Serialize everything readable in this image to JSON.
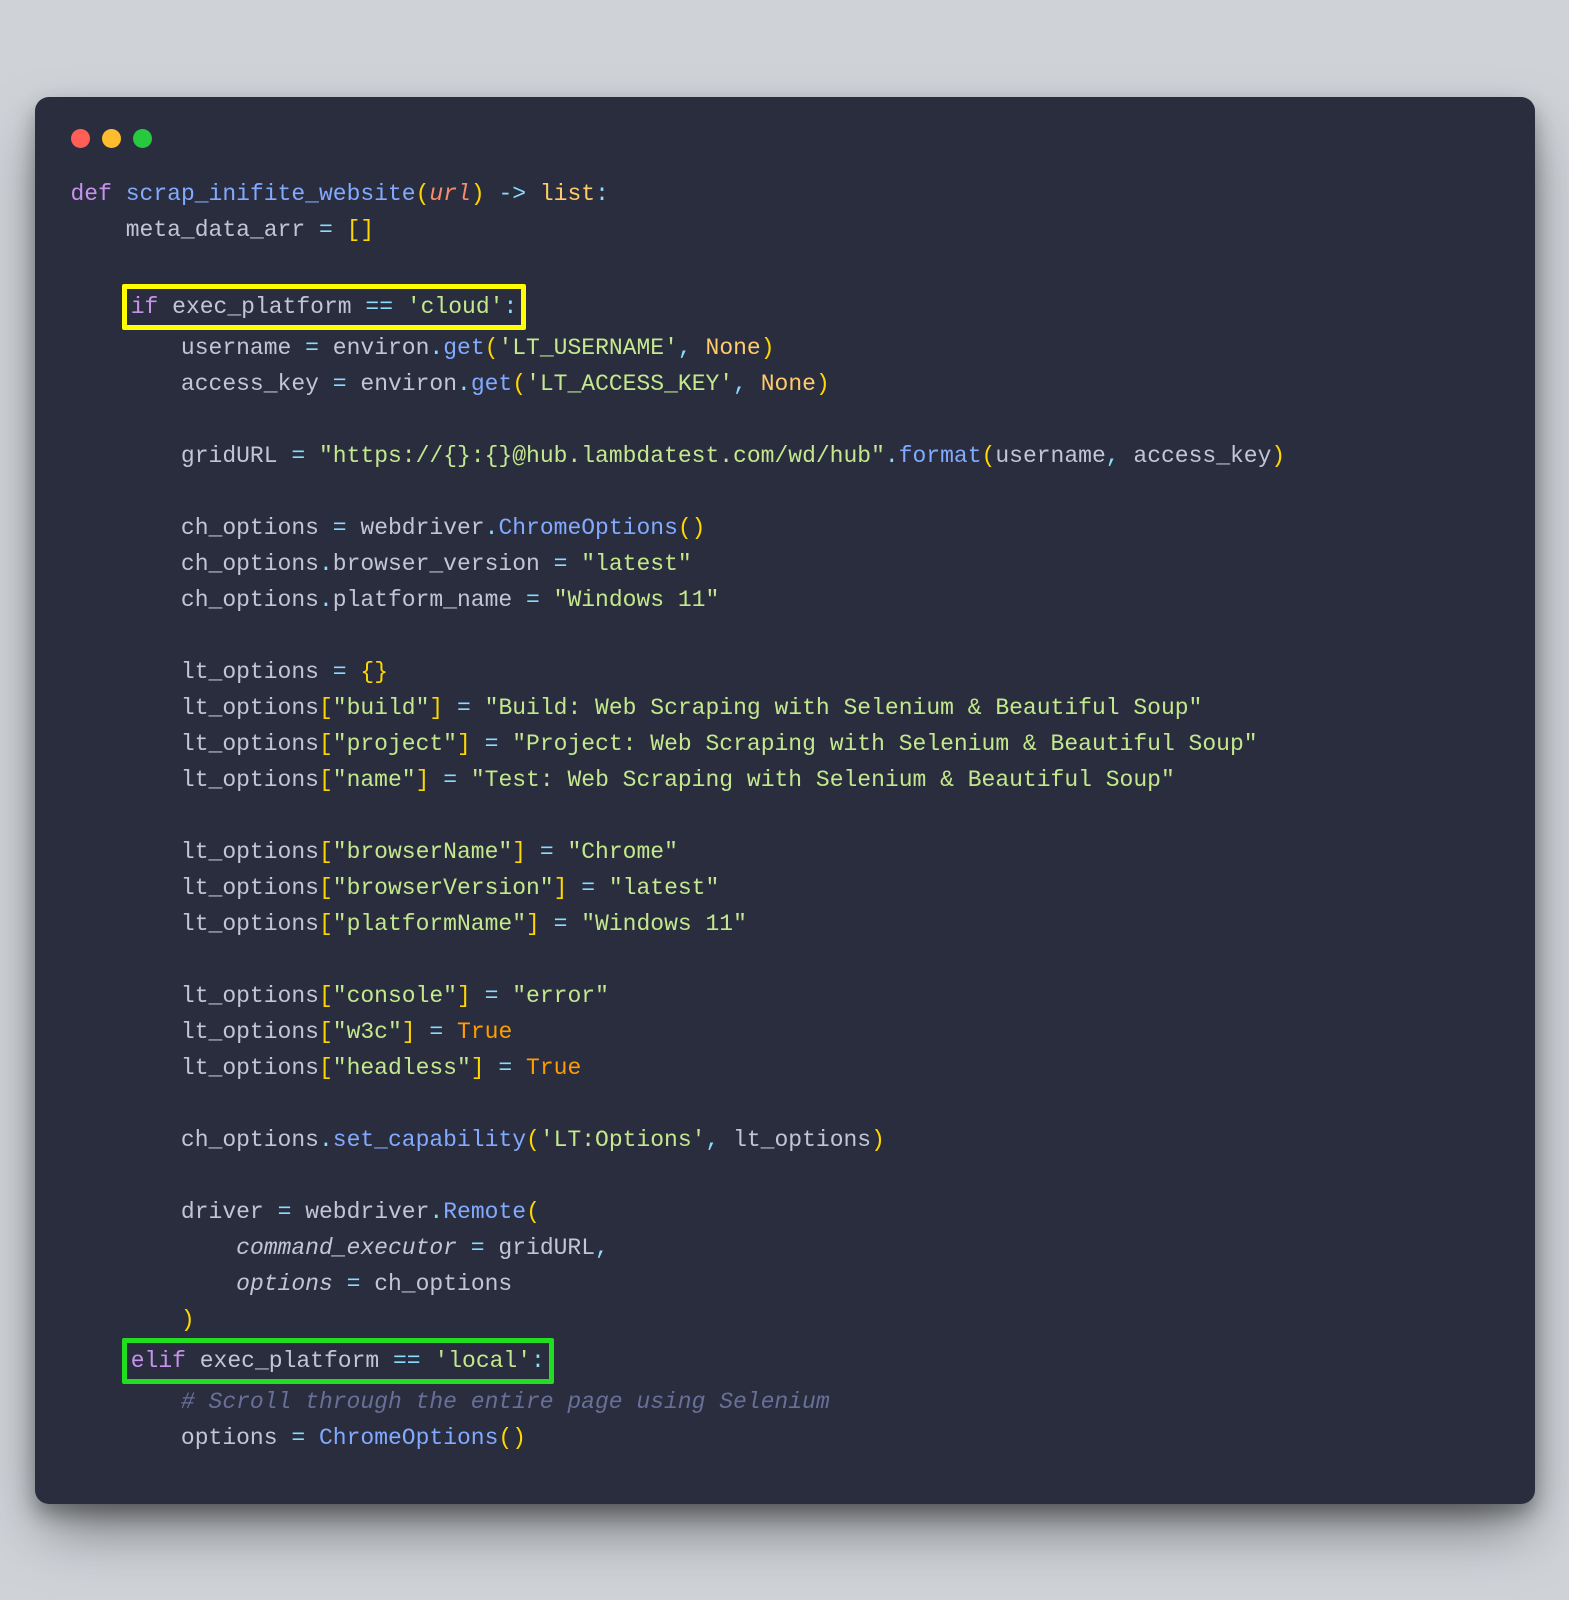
{
  "code": {
    "fn_def": {
      "kw": "def",
      "name": "scrap_inifite_website",
      "param": "url",
      "arrow": "->",
      "ret": "list"
    },
    "l2": {
      "var": "meta_data_arr",
      "eq": "=",
      "val": "[]"
    },
    "if_line": {
      "kw": "if",
      "var": "exec_platform",
      "op": "==",
      "str": "'cloud'",
      "colon": ":"
    },
    "l_user": {
      "var": "username",
      "eq": "=",
      "obj": "environ",
      "dot": ".",
      "m": "get",
      "a1": "'LT_USERNAME'",
      "c": ",",
      "a2": "None"
    },
    "l_key": {
      "var": "access_key",
      "eq": "=",
      "obj": "environ",
      "dot": ".",
      "m": "get",
      "a1": "'LT_ACCESS_KEY'",
      "c": ",",
      "a2": "None"
    },
    "l_grid": {
      "var": "gridURL",
      "eq": "=",
      "s": "\"https://{}:{}@hub.lambdatest.com/wd/hub\"",
      "dot": ".",
      "m": "format",
      "a1": "username",
      "c": ",",
      "a2": "access_key"
    },
    "l_opt": {
      "var": "ch_options",
      "eq": "=",
      "obj": "webdriver",
      "dot": ".",
      "m": "ChromeOptions"
    },
    "l_bv": {
      "obj": "ch_options",
      "dot": ".",
      "p": "browser_version",
      "eq": "=",
      "s": "\"latest\""
    },
    "l_pn": {
      "obj": "ch_options",
      "dot": ".",
      "p": "platform_name",
      "eq": "=",
      "s": "\"Windows 11\""
    },
    "l_lt": {
      "var": "lt_options",
      "eq": "=",
      "v": "{}"
    },
    "lt_build": {
      "obj": "lt_options",
      "k": "\"build\"",
      "eq": "=",
      "s": "\"Build: Web Scraping with Selenium & Beautiful Soup\""
    },
    "lt_proj": {
      "obj": "lt_options",
      "k": "\"project\"",
      "eq": "=",
      "s": "\"Project: Web Scraping with Selenium & Beautiful Soup\""
    },
    "lt_name": {
      "obj": "lt_options",
      "k": "\"name\"",
      "eq": "=",
      "s": "\"Test: Web Scraping with Selenium & Beautiful Soup\""
    },
    "lt_bn": {
      "obj": "lt_options",
      "k": "\"browserName\"",
      "eq": "=",
      "s": "\"Chrome\""
    },
    "lt_bv": {
      "obj": "lt_options",
      "k": "\"browserVersion\"",
      "eq": "=",
      "s": "\"latest\""
    },
    "lt_pn": {
      "obj": "lt_options",
      "k": "\"platformName\"",
      "eq": "=",
      "s": "\"Windows 11\""
    },
    "lt_con": {
      "obj": "lt_options",
      "k": "\"console\"",
      "eq": "=",
      "s": "\"error\""
    },
    "lt_w3c": {
      "obj": "lt_options",
      "k": "\"w3c\"",
      "eq": "=",
      "v": "True"
    },
    "lt_hl": {
      "obj": "lt_options",
      "k": "\"headless\"",
      "eq": "=",
      "v": "True"
    },
    "set_cap": {
      "obj": "ch_options",
      "dot": ".",
      "m": "set_capability",
      "a1": "'LT:Options'",
      "c": ",",
      "a2": "lt_options"
    },
    "drv": {
      "var": "driver",
      "eq": "=",
      "obj": "webdriver",
      "dot": ".",
      "m": "Remote"
    },
    "drv_ce": {
      "p": "command_executor",
      "eq": "=",
      "v": "gridURL"
    },
    "drv_op": {
      "p": "options",
      "eq": "=",
      "v": "ch_options"
    },
    "drv_close": ")",
    "elif_line": {
      "kw": "elif",
      "var": "exec_platform",
      "op": "==",
      "str": "'local'",
      "colon": ":"
    },
    "cmt": "# Scroll through the entire page using Selenium",
    "opt2": {
      "var": "options",
      "eq": "=",
      "m": "ChromeOptions"
    }
  }
}
